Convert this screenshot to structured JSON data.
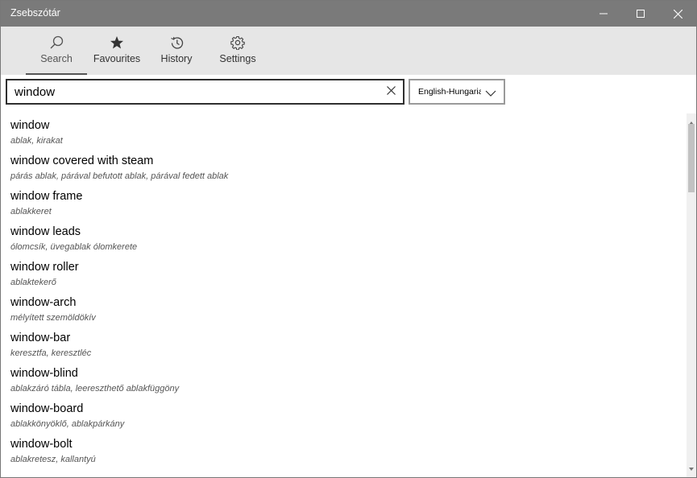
{
  "app": {
    "title": "Zsebszótár"
  },
  "window_controls": {
    "minimize": "minimize-icon",
    "maximize": "maximize-icon",
    "close": "close-icon"
  },
  "nav": {
    "tabs": [
      {
        "label": "Search",
        "icon": "search-icon",
        "active": true
      },
      {
        "label": "Favourites",
        "icon": "star-icon",
        "active": false
      },
      {
        "label": "History",
        "icon": "history-icon",
        "active": false
      },
      {
        "label": "Settings",
        "icon": "gear-icon",
        "active": false
      }
    ]
  },
  "search": {
    "value": "window",
    "placeholder": ""
  },
  "language": {
    "selected": "English-Hungarian"
  },
  "results": [
    {
      "term": "window",
      "translation": "ablak, kirakat"
    },
    {
      "term": "window covered with steam",
      "translation": "párás ablak, párával befutott ablak, párával fedett ablak"
    },
    {
      "term": "window frame",
      "translation": "ablakkeret"
    },
    {
      "term": "window leads",
      "translation": "ólomcsík, üvegablak ólomkerete"
    },
    {
      "term": "window roller",
      "translation": "ablaktekerő"
    },
    {
      "term": "window-arch",
      "translation": "mélyített szemöldökív"
    },
    {
      "term": "window-bar",
      "translation": "keresztfa, keresztléc"
    },
    {
      "term": "window-blind",
      "translation": "ablakzáró tábla, leereszthető ablakfüggöny"
    },
    {
      "term": "window-board",
      "translation": "ablakkönyöklő, ablakpárkány"
    },
    {
      "term": "window-bolt",
      "translation": "ablakretesz, kallantyú"
    }
  ],
  "colors": {
    "titlebar": "#7a7a7a",
    "navbar": "#e6e6e6",
    "accent": "#555555"
  }
}
